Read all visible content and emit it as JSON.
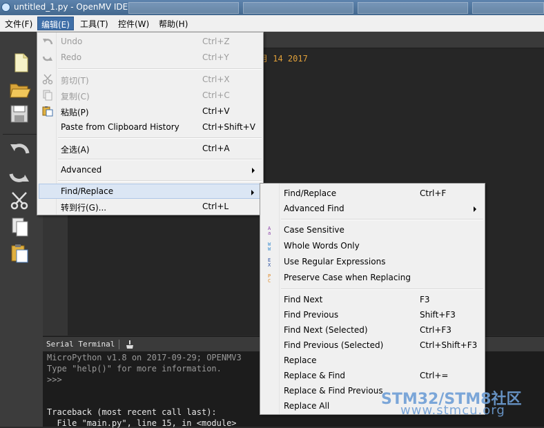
{
  "window": {
    "title": "untitled_1.py - OpenMV IDE"
  },
  "menubar": {
    "items": [
      "文件(F)",
      "编辑(E)",
      "工具(T)",
      "控件(W)",
      "帮助(H)"
    ]
  },
  "editor": {
    "visible_text": "月 14 2017"
  },
  "terminal": {
    "title": "Serial Terminal",
    "lines": [
      "MicroPython v1.8 on 2017-09-29; OPENMV3",
      "Type \"help()\" for more information.",
      ">>>",
      "",
      "",
      "Traceback (most recent call last):",
      "  File \"main.py\", line 15, in <module>"
    ]
  },
  "edit_menu": {
    "items": [
      {
        "label": "Undo",
        "shortcut": "Ctrl+Z"
      },
      {
        "label": "Redo",
        "shortcut": "Ctrl+Y"
      },
      {
        "label": "剪切(T)",
        "shortcut": "Ctrl+X"
      },
      {
        "label": "复制(C)",
        "shortcut": "Ctrl+C"
      },
      {
        "label": "粘贴(P)",
        "shortcut": "Ctrl+V"
      },
      {
        "label": "Paste from Clipboard History",
        "shortcut": "Ctrl+Shift+V"
      },
      {
        "label": "全选(A)",
        "shortcut": "Ctrl+A"
      },
      {
        "label": "Advanced",
        "shortcut": ""
      },
      {
        "label": "Find/Replace",
        "shortcut": ""
      },
      {
        "label": "转到行(G)...",
        "shortcut": "Ctrl+L"
      }
    ]
  },
  "find_menu": {
    "items": [
      {
        "label": "Find/Replace",
        "shortcut": "Ctrl+F"
      },
      {
        "label": "Advanced Find",
        "shortcut": ""
      },
      {
        "label": "Case Sensitive",
        "shortcut": ""
      },
      {
        "label": "Whole Words Only",
        "shortcut": ""
      },
      {
        "label": "Use Regular Expressions",
        "shortcut": ""
      },
      {
        "label": "Preserve Case when Replacing",
        "shortcut": ""
      },
      {
        "label": "Find Next",
        "shortcut": "F3"
      },
      {
        "label": "Find Previous",
        "shortcut": "Shift+F3"
      },
      {
        "label": "Find Next (Selected)",
        "shortcut": "Ctrl+F3"
      },
      {
        "label": "Find Previous (Selected)",
        "shortcut": "Ctrl+Shift+F3"
      },
      {
        "label": "Replace",
        "shortcut": ""
      },
      {
        "label": "Replace & Find",
        "shortcut": "Ctrl+="
      },
      {
        "label": "Replace & Find Previous",
        "shortcut": ""
      },
      {
        "label": "Replace All",
        "shortcut": ""
      }
    ]
  },
  "watermark": {
    "line1": "STM32/STM8社区",
    "line2": "www.stmcu.org"
  },
  "colors": {
    "accent": "#3f6fa8",
    "highlight": "#dbe6f4",
    "code": "#e0a03a",
    "watermark": "#6f9fd6"
  }
}
